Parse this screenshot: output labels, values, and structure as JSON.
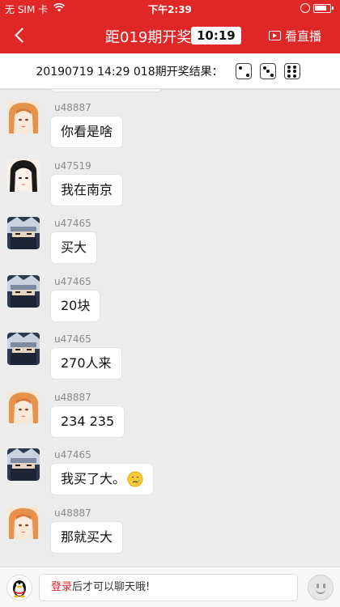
{
  "status_bar": {
    "carrier": "无 SIM 卡",
    "time": "下午2:39",
    "battery_level": 0.85
  },
  "nav": {
    "title": "距019期开奖",
    "countdown": "10:19",
    "watch_live_label": "看直播",
    "icons": {
      "back": "chevron-left-icon",
      "live": "live-tv-icon"
    }
  },
  "result_bar": {
    "text": "20190719 14:29 018期开奖结果：",
    "dice": [
      2,
      3,
      6
    ]
  },
  "messages": [
    {
      "user": "u48887",
      "text": "你看是啥",
      "avatar": "avatar-orange-hair"
    },
    {
      "user": "u47519",
      "text": "我在南京",
      "avatar": "avatar-dark-hair"
    },
    {
      "user": "u47465",
      "text": "买大",
      "avatar": "avatar-ninja"
    },
    {
      "user": "u47465",
      "text": "20块",
      "avatar": "avatar-ninja"
    },
    {
      "user": "u47465",
      "text": "270人来",
      "avatar": "avatar-ninja"
    },
    {
      "user": "u48887",
      "text": "234 235",
      "avatar": "avatar-orange-hair"
    },
    {
      "user": "u47465",
      "text": "我买了大。",
      "avatar": "avatar-ninja",
      "emoji": "crying-face-icon"
    },
    {
      "user": "u48887",
      "text": "那就买大",
      "avatar": "avatar-orange-hair"
    }
  ],
  "input_bar": {
    "login_link": "登录",
    "login_rest": "后才可以聊天哦!",
    "icons": {
      "qq": "qq-penguin-icon",
      "emoji": "smiley-icon"
    }
  },
  "colors": {
    "brand_red": "#e02727",
    "login_red": "#e02727",
    "chat_bg": "#ececec"
  }
}
